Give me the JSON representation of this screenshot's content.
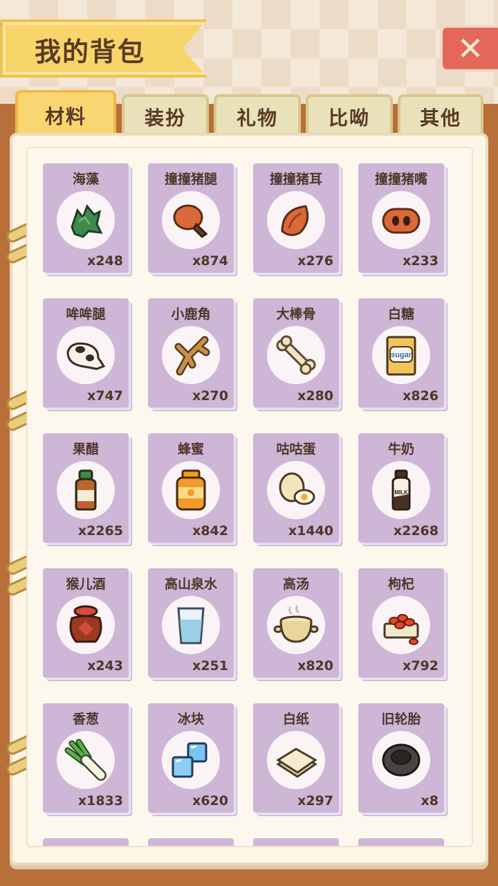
{
  "header": {
    "title": "我的背包",
    "close_icon": "close-x-icon"
  },
  "tabs": [
    {
      "label": "材料",
      "active": true
    },
    {
      "label": "装扮",
      "active": false
    },
    {
      "label": "礼物",
      "active": false
    },
    {
      "label": "比呦",
      "active": false
    },
    {
      "label": "其他",
      "active": false
    }
  ],
  "items": [
    {
      "name": "海藻",
      "count": "x248",
      "icon": "seaweed-icon"
    },
    {
      "name": "撞撞猪腿",
      "count": "x874",
      "icon": "pig-leg-icon"
    },
    {
      "name": "撞撞猪耳",
      "count": "x276",
      "icon": "pig-ear-icon"
    },
    {
      "name": "撞撞猪嘴",
      "count": "x233",
      "icon": "pig-snout-icon"
    },
    {
      "name": "哞哞腿",
      "count": "x747",
      "icon": "cow-leg-icon"
    },
    {
      "name": "小鹿角",
      "count": "x270",
      "icon": "antler-icon"
    },
    {
      "name": "大棒骨",
      "count": "x280",
      "icon": "bone-icon"
    },
    {
      "name": "白糖",
      "count": "x826",
      "icon": "sugar-bag-icon",
      "label": "sugar"
    },
    {
      "name": "果醋",
      "count": "x2265",
      "icon": "vinegar-bottle-icon"
    },
    {
      "name": "蜂蜜",
      "count": "x842",
      "icon": "honey-jar-icon"
    },
    {
      "name": "咕咕蛋",
      "count": "x1440",
      "icon": "egg-icon"
    },
    {
      "name": "牛奶",
      "count": "x2268",
      "icon": "milk-bottle-icon",
      "label": "MILK"
    },
    {
      "name": "猴儿酒",
      "count": "x243",
      "icon": "wine-jar-icon"
    },
    {
      "name": "高山泉水",
      "count": "x251",
      "icon": "water-glass-icon"
    },
    {
      "name": "高汤",
      "count": "x820",
      "icon": "soup-pot-icon"
    },
    {
      "name": "枸杞",
      "count": "x792",
      "icon": "goji-icon"
    },
    {
      "name": "香葱",
      "count": "x1833",
      "icon": "scallion-icon"
    },
    {
      "name": "冰块",
      "count": "x620",
      "icon": "ice-cube-icon"
    },
    {
      "name": "白纸",
      "count": "x297",
      "icon": "paper-stack-icon"
    },
    {
      "name": "旧轮胎",
      "count": "x8",
      "icon": "tire-icon"
    }
  ],
  "colors": {
    "card_bg": "#cdb6d6",
    "active_tab": "#f8d773",
    "banner": "#f7d56b",
    "close_button": "#e4685a",
    "wood": "#b86f3a"
  }
}
